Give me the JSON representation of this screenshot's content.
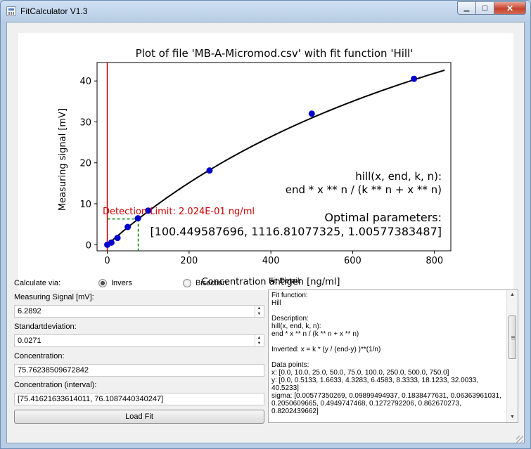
{
  "window": {
    "title": "FitCalculator V1.3",
    "controls": {
      "minimize": "▁",
      "maximize": "▢",
      "close": "✕"
    }
  },
  "chart_data": {
    "type": "scatter",
    "title": "Plot of file 'MB-A-Micromod.csv' with fit function 'Hill'",
    "xlabel": "Concentration antigen [ng/ml]",
    "ylabel": "Measuring signal [mV]",
    "xlim": [
      -25,
      840
    ],
    "ylim": [
      -1.5,
      44.5
    ],
    "xticks": [
      0,
      200,
      400,
      600,
      800
    ],
    "yticks": [
      0,
      10,
      20,
      30,
      40
    ],
    "points": {
      "x": [
        0.0,
        10.0,
        25.0,
        50.0,
        75.0,
        100.0,
        250.0,
        500.0,
        750.0
      ],
      "y": [
        0.0,
        0.5133,
        1.6633,
        4.3283,
        6.4583,
        8.3333,
        18.1233,
        32.0033,
        40.5233
      ],
      "color": "#0000cc"
    },
    "fit_curve": {
      "function": "hill",
      "params": [
        100.449587696,
        1116.81077325,
        1.00577383487
      ],
      "x_range": [
        0,
        825
      ],
      "color": "#000000"
    },
    "vertical_line": {
      "x": 0,
      "color": "#cc0000"
    },
    "detection_limit": {
      "label": "Detection Limit: 2.024E-01 ng/ml",
      "x": 75.76,
      "y": 6.29,
      "color": "#cc0000",
      "marker_color": "#008000"
    },
    "annotations": {
      "formula_line1": "hill(x, end, k, n):",
      "formula_line2": "end * x ** n / (k ** n + x ** n)",
      "params_title": "Optimal parameters:",
      "params_values": "[100.449587696, 1116.81077325, 1.00577383487]"
    }
  },
  "form": {
    "calculate_via_label": "Calculate via:",
    "radio_invers": "Invers",
    "radio_bisection": "Bisection",
    "selected": "invers",
    "measuring_signal_label": "Measuring Signal [mV]:",
    "measuring_signal_value": "6.2892",
    "stddev_label": "Standartdeviation:",
    "stddev_value": "0.0271",
    "concentration_label": "Concentration:",
    "concentration_value": "75.76238509672842",
    "interval_label": "Concentration (interval):",
    "interval_value": "[75.41621633614011, 76.1087440340247]",
    "load_fit_button": "Load Fit"
  },
  "fit_detail": {
    "title": "Fit Detail:",
    "text": "Fit function:\nHill\n\nDescription:\nhill(x, end, k, n):\nend * x ** n / (k ** n + x ** n)\n\nInverted: x = k * (y / (end-y) )**(1/n)\n\nData points:\nx: [0.0, 10.0, 25.0, 50.0, 75.0, 100.0, 250.0, 500.0, 750.0]\ny: [0.0, 0.5133, 1.6633, 4.3283, 6.4583, 8.3333, 18.1233, 32.0033, 40.5233]\nsigma: [0.00577350269, 0.09899494937, 0.1838477631, 0.06363961031, 0.2050609665, 0.4949747468, 0.1272792206, 0.862670273, 0.8202439662]"
  }
}
